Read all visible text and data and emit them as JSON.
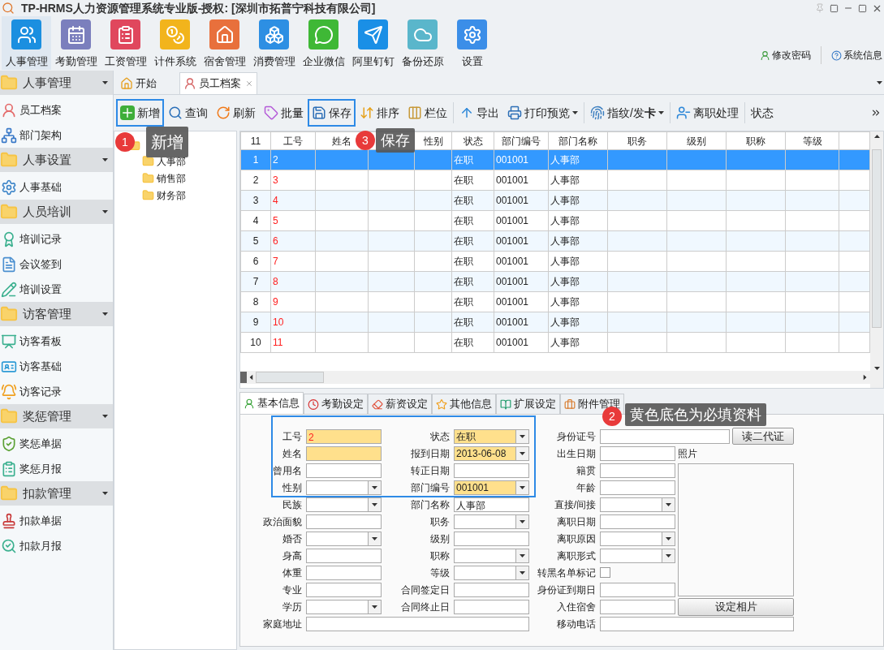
{
  "window": {
    "title": "TP-HRMS人力资源管理系统专业版-授权: [深圳市拓普宁科技有限公司]"
  },
  "modules": [
    {
      "label": "人事管理",
      "kind": "people",
      "selected": true
    },
    {
      "label": "考勤管理",
      "kind": "calendar",
      "selected": false
    },
    {
      "label": "工资管理",
      "kind": "salary",
      "selected": false
    },
    {
      "label": "计件系统",
      "kind": "piece",
      "selected": false
    },
    {
      "label": "宿舍管理",
      "kind": "dorm",
      "selected": false
    },
    {
      "label": "消费管理",
      "kind": "consume",
      "selected": false
    },
    {
      "label": "企业微信",
      "kind": "wechat",
      "selected": false
    },
    {
      "label": "阿里钉钉",
      "kind": "dingtalk",
      "selected": false
    },
    {
      "label": "备份还原",
      "kind": "backup",
      "selected": false
    },
    {
      "label": "设置",
      "kind": "settings",
      "selected": false
    }
  ],
  "account_links": [
    {
      "label": "修改密码",
      "kind": "user"
    },
    {
      "label": "系统信息",
      "kind": "help"
    }
  ],
  "sidebar": {
    "groups": [
      {
        "title": "人事管理",
        "expanded": true,
        "items": [
          {
            "label": "员工档案",
            "kind": "person"
          },
          {
            "label": "部门架构",
            "kind": "org"
          }
        ]
      },
      {
        "title": "人事设置",
        "expanded": true,
        "items": [
          {
            "label": "人事基础",
            "kind": "gear"
          }
        ]
      },
      {
        "title": "人员培训",
        "expanded": true,
        "items": [
          {
            "label": "培训记录",
            "kind": "training"
          },
          {
            "label": "会议签到",
            "kind": "meeting"
          },
          {
            "label": "培训设置",
            "kind": "training-set"
          }
        ]
      },
      {
        "title": "访客管理",
        "expanded": true,
        "items": [
          {
            "label": "访客看板",
            "kind": "board"
          },
          {
            "label": "访客基础",
            "kind": "visitor-base"
          },
          {
            "label": "访客记录",
            "kind": "visitor-log"
          }
        ]
      },
      {
        "title": "奖惩管理",
        "expanded": true,
        "items": [
          {
            "label": "奖惩单据",
            "kind": "reward"
          },
          {
            "label": "奖惩月报",
            "kind": "report"
          }
        ]
      },
      {
        "title": "扣款管理",
        "expanded": true,
        "items": [
          {
            "label": "扣款单据",
            "kind": "deduct"
          },
          {
            "label": "扣款月报",
            "kind": "deduct-report"
          }
        ]
      }
    ]
  },
  "tabs": [
    {
      "label": "开始",
      "kind": "home",
      "selected": false,
      "closable": false
    },
    {
      "label": "员工档案",
      "kind": "person",
      "selected": true,
      "closable": true
    }
  ],
  "toolbar": [
    {
      "label": "新增",
      "kind": "add",
      "highlighted": true,
      "dropdown": false
    },
    {
      "label": "查询",
      "kind": "search",
      "highlighted": false,
      "dropdown": false
    },
    {
      "label": "刷新",
      "kind": "refresh",
      "highlighted": false,
      "dropdown": false
    },
    {
      "label": "批量",
      "kind": "batch",
      "highlighted": false,
      "dropdown": false
    },
    {
      "label": "保存",
      "kind": "save",
      "highlighted": true,
      "dropdown": false
    },
    {
      "label": "排序",
      "kind": "sort",
      "highlighted": false,
      "dropdown": false
    },
    {
      "label": "栏位",
      "kind": "columns",
      "highlighted": false,
      "dropdown": false
    },
    {
      "label": "导出",
      "kind": "export",
      "highlighted": false,
      "dropdown": false
    },
    {
      "label": "打印预览",
      "kind": "print",
      "highlighted": false,
      "dropdown": true
    },
    {
      "label": "指纹/发**卡**",
      "kind": "card",
      "highlighted": false,
      "dropdown": true
    },
    {
      "label": "离职处理",
      "kind": "leave",
      "highlighted": false,
      "dropdown": false
    },
    {
      "label": "状态",
      "kind": "text",
      "highlighted": false,
      "dropdown": false
    }
  ],
  "tree": {
    "children": [
      {
        "label": "人事部"
      },
      {
        "label": "销售部"
      },
      {
        "label": "财务部"
      }
    ]
  },
  "grid": {
    "row_count": "11",
    "columns": [
      {
        "label": "工号"
      },
      {
        "label": "姓名"
      },
      {},
      {
        "label": "性别"
      },
      {
        "label": "状态"
      },
      {
        "label": "部门编号"
      },
      {
        "label": "部门名称"
      },
      {
        "label": "职务"
      },
      {
        "label": "级别"
      },
      {
        "label": "职称"
      },
      {
        "label": "等级"
      }
    ],
    "rows": [
      {
        "number": "1",
        "id": "2",
        "status": "在职",
        "dept_code": "001001",
        "dept_name": "人事部",
        "selected": true
      },
      {
        "number": "2",
        "id": "3",
        "status": "在职",
        "dept_code": "001001",
        "dept_name": "人事部",
        "selected": false
      },
      {
        "number": "3",
        "id": "4",
        "status": "在职",
        "dept_code": "001001",
        "dept_name": "人事部",
        "selected": false
      },
      {
        "number": "4",
        "id": "5",
        "status": "在职",
        "dept_code": "001001",
        "dept_name": "人事部",
        "selected": false
      },
      {
        "number": "5",
        "id": "6",
        "status": "在职",
        "dept_code": "001001",
        "dept_name": "人事部",
        "selected": false
      },
      {
        "number": "6",
        "id": "7",
        "status": "在职",
        "dept_code": "001001",
        "dept_name": "人事部",
        "selected": false
      },
      {
        "number": "7",
        "id": "8",
        "status": "在职",
        "dept_code": "001001",
        "dept_name": "人事部",
        "selected": false
      },
      {
        "number": "8",
        "id": "9",
        "status": "在职",
        "dept_code": "001001",
        "dept_name": "人事部",
        "selected": false
      },
      {
        "number": "9",
        "id": "10",
        "status": "在职",
        "dept_code": "001001",
        "dept_name": "人事部",
        "selected": false
      },
      {
        "number": "10",
        "id": "11",
        "status": "在职",
        "dept_code": "001001",
        "dept_name": "人事部",
        "selected": false
      }
    ]
  },
  "detail_tabs": [
    {
      "label": "基本信息",
      "kind": "person",
      "selected": true
    },
    {
      "label": "考勤设定",
      "kind": "clock",
      "selected": false
    },
    {
      "label": "薪资设定",
      "kind": "eraser",
      "selected": false
    },
    {
      "label": "其他信息",
      "kind": "star",
      "selected": false
    },
    {
      "label": "扩展设定",
      "kind": "book",
      "selected": false
    },
    {
      "label": "附件管理",
      "kind": "briefcase",
      "selected": false
    }
  ],
  "form": {
    "columns": [
      [
        {
          "label": "工号",
          "kind": "id",
          "required": true,
          "value": "2"
        },
        {
          "label": "姓名",
          "kind": "text",
          "required": true
        },
        {
          "label": "曾用名",
          "kind": "text",
          "required": false
        },
        {
          "label": "性别",
          "kind": "select",
          "required": false
        },
        {
          "label": "民族",
          "kind": "select",
          "required": false
        },
        {
          "label": "政治面貌",
          "kind": "text",
          "required": false
        },
        {
          "label": "婚否",
          "kind": "select",
          "required": false
        },
        {
          "label": "身高",
          "kind": "text",
          "required": false
        },
        {
          "label": "体重",
          "kind": "text",
          "required": false
        },
        {
          "label": "专业",
          "kind": "text",
          "required": false
        },
        {
          "label": "学历",
          "kind": "select",
          "required": false
        },
        {
          "label": "家庭地址",
          "kind": "text",
          "required": false,
          "wide": true
        }
      ],
      [
        {
          "label": "状态",
          "kind": "select",
          "required": true,
          "value": "在职"
        },
        {
          "label": "报到日期",
          "kind": "select",
          "required": true,
          "value": "2013-06-08"
        },
        {
          "label": "转正日期",
          "kind": "text",
          "required": false
        },
        {
          "label": "部门编号",
          "kind": "select",
          "required": true,
          "value": "001001"
        },
        {
          "label": "部门名称",
          "kind": "text",
          "required": false,
          "value": "人事部"
        },
        {
          "label": "职务",
          "kind": "select",
          "required": false
        },
        {
          "label": "级别",
          "kind": "text",
          "required": false
        },
        {
          "label": "职称",
          "kind": "select",
          "required": false
        },
        {
          "label": "等级",
          "kind": "select",
          "required": false
        },
        {
          "label": "合同签定日",
          "kind": "text",
          "required": false
        },
        {
          "label": "合同终止日",
          "kind": "text",
          "required": false
        }
      ],
      [
        {
          "label": "身份证号",
          "kind": "text",
          "required": false,
          "wide": true
        },
        {
          "label": "出生日期",
          "kind": "text",
          "required": false
        },
        {
          "label": "籍贯",
          "kind": "text",
          "required": false
        },
        {
          "label": "年龄",
          "kind": "text",
          "required": false
        },
        {
          "label": "直接/间接",
          "kind": "select",
          "required": false
        },
        {
          "label": "离职日期",
          "kind": "text",
          "required": false
        },
        {
          "label": "离职原因",
          "kind": "select",
          "required": false
        },
        {
          "label": "离职形式",
          "kind": "select",
          "required": false
        },
        {
          "label": "转黑名单标记",
          "kind": "checkbox",
          "checked": false
        },
        {
          "label": "身份证到期日",
          "kind": "text",
          "required": false
        },
        {
          "label": "入住宿舍",
          "kind": "text",
          "required": false
        },
        {
          "label": "移动电话",
          "kind": "text",
          "required": false,
          "wide": true
        }
      ]
    ],
    "id_card_button": "读二代证",
    "photo_label": "照片",
    "photo_button": "设定相片"
  },
  "callouts": [
    {
      "number": "1",
      "text": "新增"
    },
    {
      "number": "3",
      "text": "保存"
    },
    {
      "number": "2",
      "text": "黄色底色为必填资料"
    }
  ]
}
